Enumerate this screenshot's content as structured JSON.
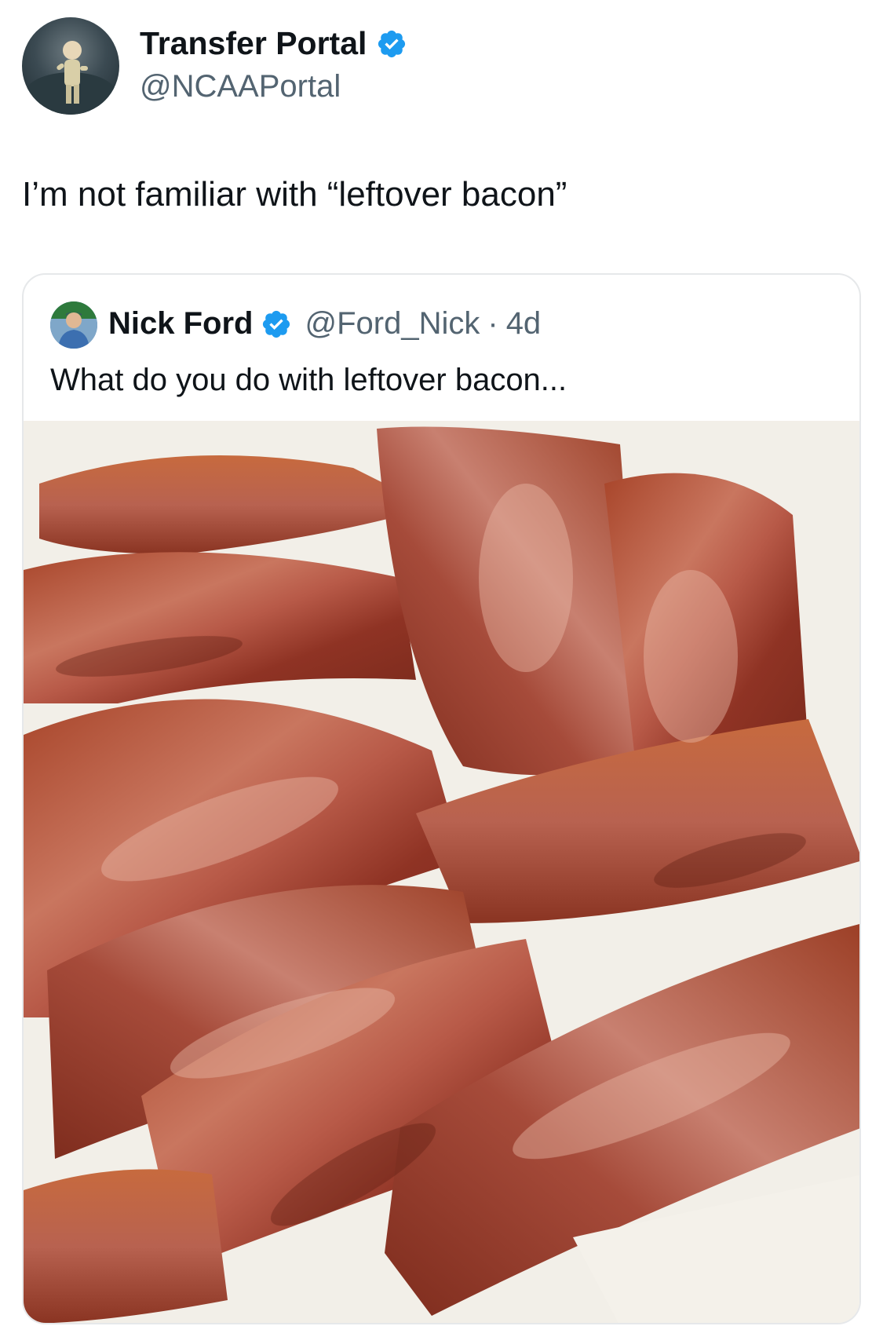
{
  "tweet": {
    "author": {
      "display_name": "Transfer Portal",
      "handle": "@NCAAPortal",
      "verified_icon": "verified-badge-icon"
    },
    "text": "I’m not familiar with “leftover bacon”"
  },
  "quoted_tweet": {
    "author": {
      "display_name": "Nick Ford",
      "handle": "@Ford_Nick",
      "verified_icon": "verified-badge-icon"
    },
    "separator": "·",
    "time_ago": "4d",
    "text": "What do you do with leftover bacon...",
    "media": {
      "description_icon": "photo-image"
    }
  },
  "colors": {
    "verified_blue": "#1d9bf0",
    "secondary_text": "#536471",
    "primary_text": "#0f1419",
    "card_border": "#e6e8ea"
  }
}
